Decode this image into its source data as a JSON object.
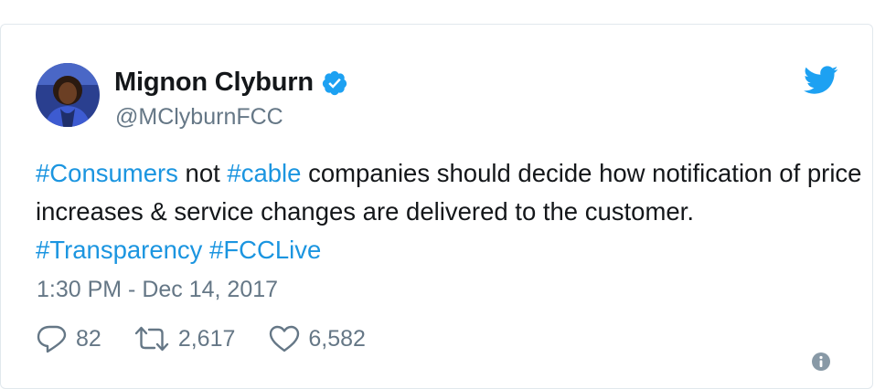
{
  "author": {
    "display_name": "Mignon Clyburn",
    "handle": "@MClyburnFCC",
    "verified": true,
    "avatar_icon": "profile-photo"
  },
  "tweet": {
    "segments": [
      {
        "text": "#Consumers",
        "type": "hashtag"
      },
      {
        "text": " not ",
        "type": "text"
      },
      {
        "text": "#cable",
        "type": "hashtag"
      },
      {
        "text": " companies should decide how notification of price increases & service changes are delivered to the customer. ",
        "type": "text"
      },
      {
        "text": "#Transparency",
        "type": "hashtag"
      },
      {
        "text": " ",
        "type": "text"
      },
      {
        "text": "#FCCLive",
        "type": "hashtag"
      }
    ],
    "timestamp": "1:30 PM - Dec 14, 2017"
  },
  "actions": {
    "reply_count": "82",
    "retweet_count": "2,617",
    "like_count": "6,582"
  },
  "icons": {
    "brand": "twitter-bird-icon",
    "verified": "verified-badge-icon",
    "reply": "reply-icon",
    "retweet": "retweet-icon",
    "like": "heart-icon",
    "info": "info-icon"
  },
  "colors": {
    "brand_blue": "#1da1f2",
    "hashtag_blue": "#1b95e0",
    "text_primary": "#14171a",
    "text_secondary": "#657786",
    "card_border": "#e1e8ed"
  }
}
